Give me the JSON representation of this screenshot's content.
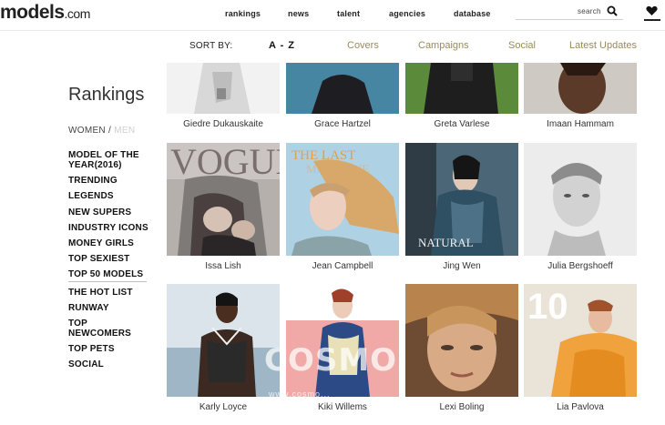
{
  "header": {
    "logo_main": "models",
    "logo_suffix": ".com",
    "nav": [
      "rankings",
      "news",
      "talent",
      "agencies",
      "database"
    ],
    "search_placeholder": "search",
    "search_icon": "magnifier",
    "favorites_icon": "heart"
  },
  "sort": {
    "label": "SORT BY:",
    "options": [
      "A - Z",
      "Covers",
      "Campaigns",
      "Social",
      "Latest Updates"
    ],
    "active": "A - Z",
    "colors": {
      "option": "#9a8a5a",
      "active": "#111111"
    }
  },
  "sidebar": {
    "title": "Rankings",
    "gender_women": "WOMEN",
    "gender_sep": "/",
    "gender_men": "MEN",
    "items": [
      "MODEL OF THE YEAR(2016)",
      "TRENDING",
      "LEGENDS",
      "NEW SUPERS",
      "INDUSTRY ICONS",
      "MONEY GIRLS",
      "TOP SEXIEST",
      "TOP 50 MODELS",
      "THE HOT LIST",
      "RUNWAY",
      "TOP NEWCOMERS",
      "TOP PETS",
      "SOCIAL"
    ]
  },
  "models": [
    {
      "name": "Giedre Dukauskaite"
    },
    {
      "name": "Grace Hartzel"
    },
    {
      "name": "Greta Varlese"
    },
    {
      "name": "Imaan Hammam"
    },
    {
      "name": "Issa Lish",
      "cover_text": "VOGUE"
    },
    {
      "name": "Jean Campbell",
      "cover_text": "THE LAST MAGAZINE"
    },
    {
      "name": "Jing Wen",
      "cover_text": "NATURAL"
    },
    {
      "name": "Julia Bergshoeff"
    },
    {
      "name": "Karly Loyce"
    },
    {
      "name": "Kiki Willems"
    },
    {
      "name": "Lexi Boling"
    },
    {
      "name": "Lia Pavlova",
      "cover_text": "10"
    }
  ],
  "watermark": {
    "text": "COSMO",
    "sub": "www.cosmo..."
  }
}
